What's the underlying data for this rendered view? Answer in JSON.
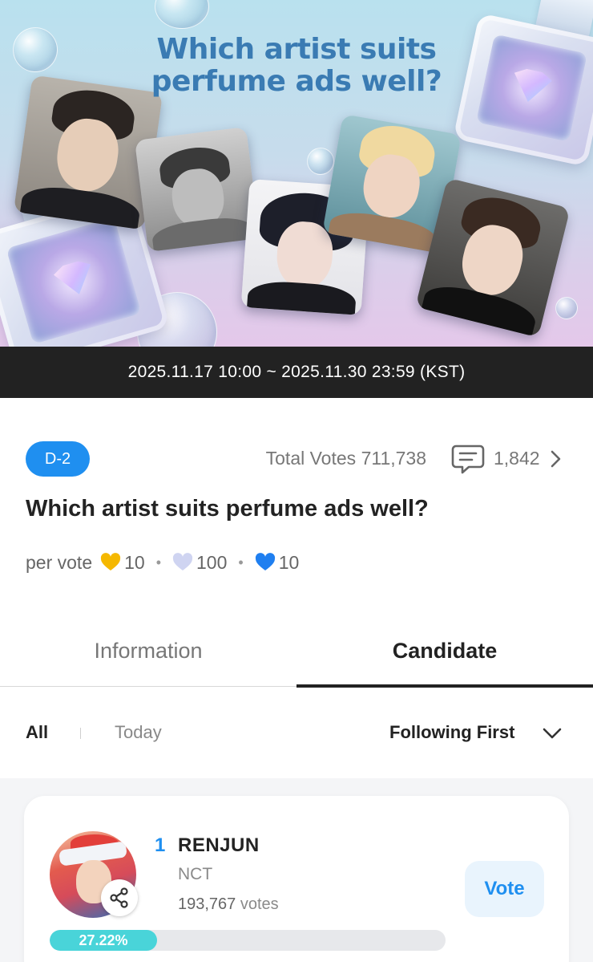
{
  "banner": {
    "title": "Which artist suits perfume ads well?",
    "period": "2025.11.17 10:00 ~ 2025.11.30 23:59 (KST)"
  },
  "summary": {
    "dday": "D-2",
    "total_votes_label": "Total Votes",
    "total_votes": "711,738",
    "comment_count": "1,842",
    "title": "Which artist suits perfume ads well?",
    "per_vote_label": "per vote",
    "costs": [
      {
        "icon": "gold-heart-icon",
        "value": "10",
        "color": "#f5b800"
      },
      {
        "icon": "lavender-heart-icon",
        "value": "100",
        "color": "#cfd4f1"
      },
      {
        "icon": "blue-heart-icon",
        "value": "10",
        "color": "#1f7ff0"
      }
    ]
  },
  "tabs": [
    {
      "label": "Information",
      "active": false
    },
    {
      "label": "Candidate",
      "active": true
    }
  ],
  "filters": {
    "all": "All",
    "today": "Today",
    "sort": "Following First"
  },
  "candidates": [
    {
      "rank": "1",
      "name": "RENJUN",
      "group": "NCT",
      "votes": "193,767",
      "votes_unit": "votes",
      "percent_label": "27.22%",
      "percent": 27.22,
      "vote_label": "Vote"
    }
  ],
  "colors": {
    "accent": "#1f8ff0",
    "progress": "#49d4d9",
    "date_bar": "#222222"
  }
}
